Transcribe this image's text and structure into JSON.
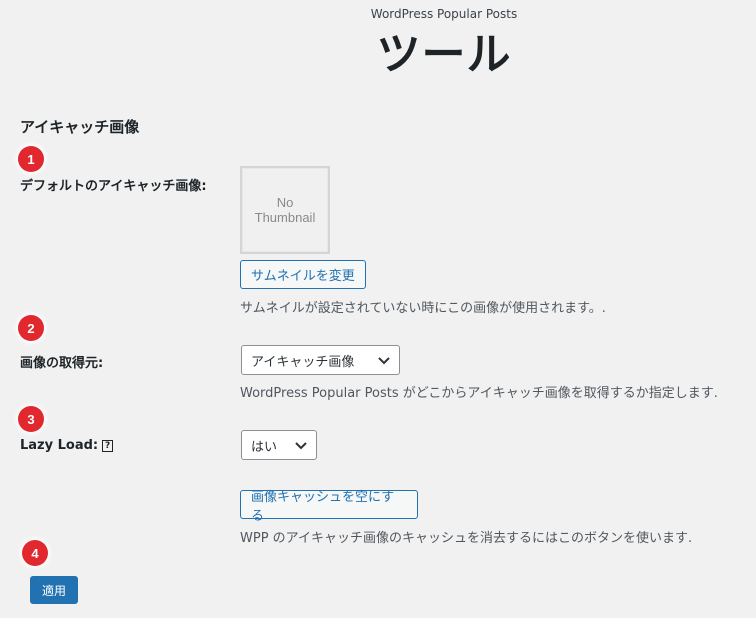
{
  "header": {
    "plugin_name": "WordPress Popular Posts",
    "page_title": "ツール"
  },
  "section": {
    "heading": "アイキャッチ画像"
  },
  "badges": [
    "1",
    "2",
    "3",
    "4"
  ],
  "default_thumbnail": {
    "label": "デフォルトのアイキャッチ画像:",
    "placeholder_line1": "No",
    "placeholder_line2": "Thumbnail",
    "change_button": "サムネイルを変更",
    "description": "サムネイルが設定されていない時にこの画像が使用されます。."
  },
  "image_source": {
    "label": "画像の取得元:",
    "selected": "アイキャッチ画像",
    "description": "WordPress Popular Posts がどこからアイキャッチ画像を取得するか指定します."
  },
  "lazy_load": {
    "label": "Lazy Load:",
    "help": "?",
    "selected": "はい"
  },
  "cache": {
    "button": "画像キャッシュを空にする",
    "description": "WPP のアイキャッチ画像のキャッシュを消去するにはこのボタンを使います."
  },
  "apply_button": "適用",
  "colors": {
    "accent": "#2271b1",
    "badge": "#e0282e",
    "background": "#f1f1f1"
  }
}
